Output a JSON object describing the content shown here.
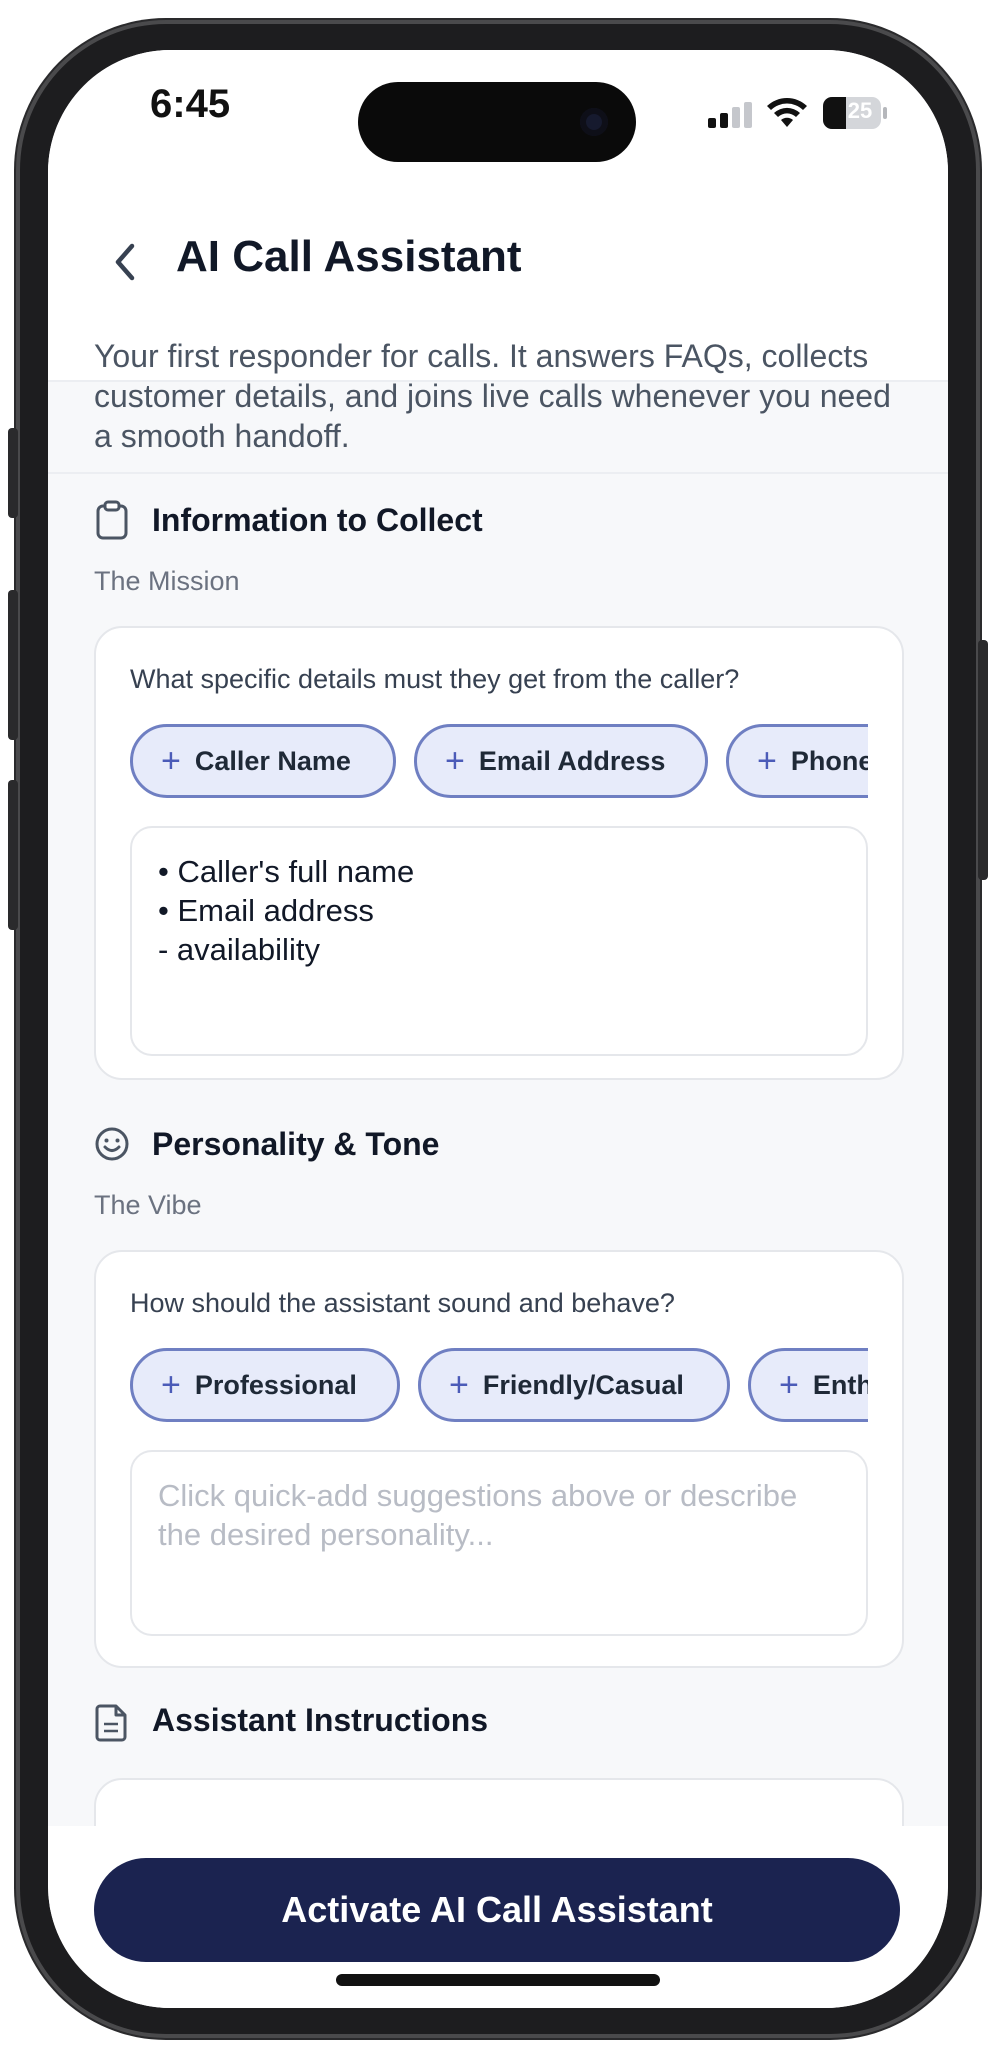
{
  "status": {
    "time": "6:45",
    "battery": "25"
  },
  "header": {
    "title": "AI Call Assistant"
  },
  "intro": "Your first responder for calls. It answers FAQs, collects customer details, and joins live calls whenever you need a smooth handoff.",
  "info_section": {
    "title": "Information to Collect",
    "subtitle": "The Mission",
    "prompt": "What specific details must they get from the caller?",
    "chips": [
      "Caller Name",
      "Email Address",
      "Phone"
    ],
    "value": "• Caller's full name\n• Email address\n- availability"
  },
  "personality_section": {
    "title": "Personality & Tone",
    "subtitle": "The Vibe",
    "prompt": "How should the assistant sound and behave?",
    "chips": [
      "Professional",
      "Friendly/Casual",
      "Enthusiastic"
    ],
    "placeholder": "Click quick-add suggestions above or describe the desired personality..."
  },
  "instructions_section": {
    "title": "Assistant Instructions"
  },
  "footer": {
    "activate_label": "Activate AI Call Assistant"
  },
  "colors": {
    "primary": "#1b2350",
    "chip_bg": "#e7ebfa",
    "chip_border": "#6f7fc2",
    "accent": "#4b5bb8"
  }
}
